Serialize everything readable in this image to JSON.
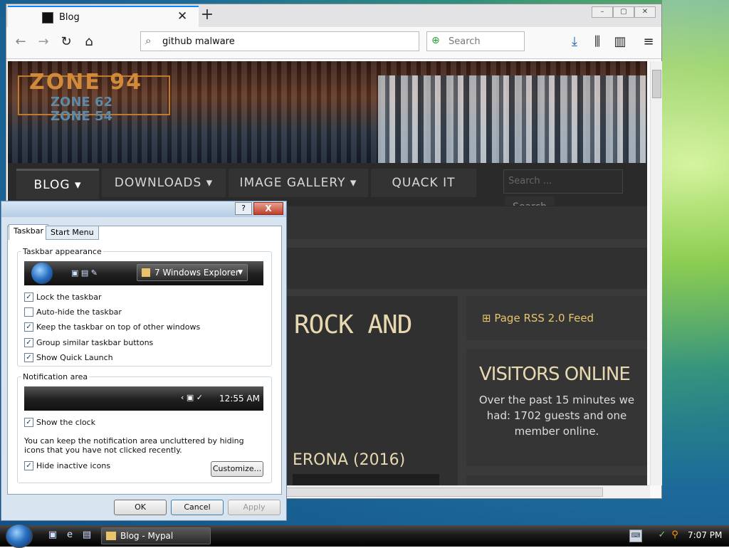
{
  "browser": {
    "tab_title": "Blog",
    "new_tab_icon": "+",
    "close_tab_icon": "✕",
    "url_value": "github malware",
    "search_placeholder": "Search"
  },
  "page": {
    "logo_main": "ZONE 94",
    "logo_sub1": "ZONE 62",
    "logo_sub2": "ZONE 54",
    "menu": [
      {
        "label": "BLOG"
      },
      {
        "label": "DOWNLOADS"
      },
      {
        "label": "IMAGE GALLERY"
      },
      {
        "label": "QUACK IT"
      }
    ],
    "search_placeholder": "Search ...",
    "search_button": "Search",
    "post_title": "ROCK AND",
    "post_subtitle": "ERONA (2016)",
    "rss_link": "Page RSS 2.0 Feed",
    "visitors_heading": "VISITORS ONLINE",
    "visitors_text": "Over the past 15 minutes we had: 1702 guests and one member online."
  },
  "dialog": {
    "help_label": "?",
    "close_label": "X",
    "tabs": [
      {
        "label": "Taskbar"
      },
      {
        "label": "Start Menu"
      }
    ],
    "taskbar_appearance": {
      "title": "Taskbar appearance",
      "preview_button": "7 Windows Explorer",
      "options": [
        {
          "label": "Lock the taskbar",
          "checked": true
        },
        {
          "label": "Auto-hide the taskbar",
          "checked": false
        },
        {
          "label": "Keep the taskbar on top of other windows",
          "checked": true
        },
        {
          "label": "Group similar taskbar buttons",
          "checked": true
        },
        {
          "label": "Show Quick Launch",
          "checked": true
        }
      ]
    },
    "notification_area": {
      "title": "Notification area",
      "preview_time": "12:55 AM",
      "show_clock": {
        "label": "Show the clock",
        "checked": true
      },
      "description": "You can keep the notification area uncluttered by hiding icons that you have not clicked recently.",
      "hide_inactive": {
        "label": "Hide inactive icons",
        "checked": true
      },
      "customize_button": "Customize..."
    },
    "buttons": {
      "ok": "OK",
      "cancel": "Cancel",
      "apply": "Apply"
    }
  },
  "taskbar": {
    "task_button": "Blog - Mypal",
    "clock": "7:07 PM"
  }
}
